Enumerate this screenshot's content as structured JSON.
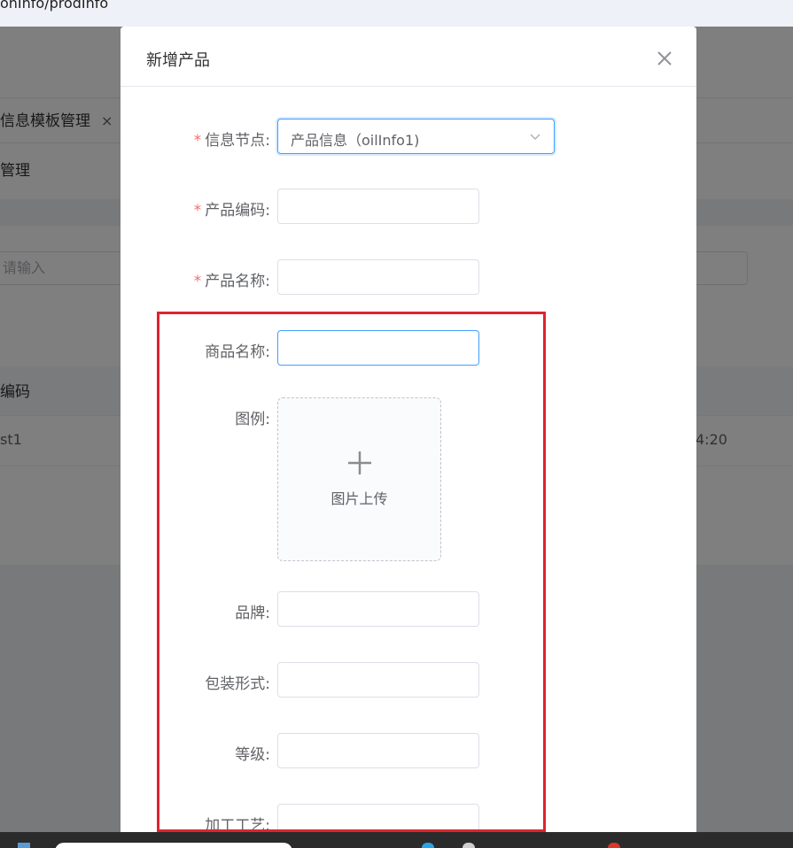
{
  "browser": {
    "url_text": "onInfo/prodInfo"
  },
  "background": {
    "tab_label": "信息模板管理",
    "tab_close": "×",
    "breadcrumb": "管理",
    "search_placeholder": "请输入",
    "table_header": "编码",
    "row_col1": "st1",
    "row_col2": "4:20"
  },
  "dialog": {
    "title": "新增产品",
    "close_icon": "close-icon",
    "required_mark": "*",
    "fields": {
      "node": {
        "label": "信息节点:",
        "value": "产品信息（oilInfo1)"
      },
      "code": {
        "label": "产品编码:",
        "value": ""
      },
      "name": {
        "label": "产品名称:",
        "value": ""
      },
      "goods_name": {
        "label": "商品名称:",
        "value": ""
      },
      "legend": {
        "label": "图例:",
        "upload_text": "图片上传"
      },
      "brand": {
        "label": "品牌:",
        "value": ""
      },
      "packaging": {
        "label": "包装形式:",
        "value": ""
      },
      "grade": {
        "label": "等级:",
        "value": ""
      },
      "process": {
        "label": "加工工艺:",
        "value": ""
      }
    }
  },
  "colors": {
    "primary": "#409eff",
    "required": "#f56c6c",
    "highlight": "#e0232e"
  }
}
